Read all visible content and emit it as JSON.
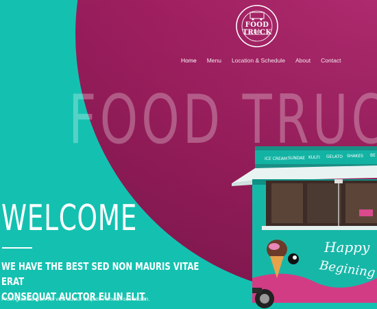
{
  "brand": {
    "logo_title": "FOOD TRUCK",
    "logo_year": "1985",
    "logo_ring_top": "QUALITY BEGINS WITH A FR",
    "logo_ring_bottom": "FREE GRANDBLE PROD"
  },
  "nav": {
    "items": [
      {
        "label": "Home",
        "active": true
      },
      {
        "label": "Menu",
        "active": false
      },
      {
        "label": "Location & Schedule",
        "active": false
      },
      {
        "label": "About",
        "active": false
      },
      {
        "label": "Contact",
        "active": false
      }
    ]
  },
  "hero": {
    "background_title": "FOOD TRUCK",
    "heading": "WELCOME",
    "tagline": "WE HAVE THE BEST SED NON MAURIS VITAE ERAT\nCONSEQUAT AUCTOR EU IN ELIT.",
    "body": "Proin gravida nibh vel velit auctor aliquet. Aenean sollicitudin."
  },
  "truck": {
    "menu_labels": [
      "ICE CREAM",
      "SUNDAE",
      "KULFI",
      "GELATO",
      "SHAKES",
      "BE"
    ],
    "side_text_1": "Happy",
    "side_text_2": "Begining"
  },
  "colors": {
    "teal": "#14c1b0",
    "magenta": "#a01f60",
    "white": "#ffffff"
  }
}
